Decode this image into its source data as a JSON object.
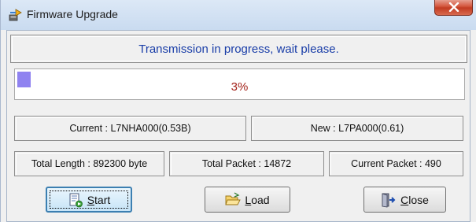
{
  "window": {
    "title": "Firmware Upgrade",
    "app_icon": "firmware-upgrade-icon",
    "close_icon": "close-icon"
  },
  "status": {
    "message": "Transmission in progress, wait please.",
    "color": "#1a3ea8"
  },
  "progress": {
    "percent": 3,
    "label": "3%",
    "fill_color": "#8f82f0",
    "text_color": "#a3221a"
  },
  "versions": {
    "current": "Current : L7NHA000(0.53B)",
    "new": "New : L7PA000(0.61)"
  },
  "stats": {
    "total_length": "Total Length : 892300 byte",
    "total_packet": "Total Packet : 14872",
    "current_packet": "Current Packet : 490"
  },
  "buttons": {
    "start": {
      "mnemonic": "S",
      "rest": "tart",
      "icon": "start-icon"
    },
    "load": {
      "mnemonic": "L",
      "rest": "oad",
      "icon": "folder-open-icon"
    },
    "close": {
      "mnemonic": "C",
      "rest": "lose",
      "icon": "exit-door-icon"
    }
  }
}
